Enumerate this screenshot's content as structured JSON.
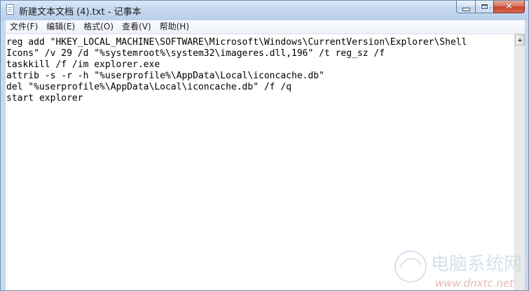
{
  "window": {
    "title": "新建文本文档 (4).txt - 记事本",
    "colors": {
      "frame": "#c7d9ed",
      "close_button": "#c7402b",
      "text": "#000000",
      "background": "#ffffff"
    }
  },
  "titlebar": {
    "app_icon": "notepad-icon",
    "buttons": {
      "minimize": "minimize-icon",
      "maximize": "maximize-icon",
      "close": "close-icon"
    }
  },
  "menubar": {
    "items": [
      {
        "label": "文件(F)"
      },
      {
        "label": "编辑(E)"
      },
      {
        "label": "格式(O)"
      },
      {
        "label": "查看(V)"
      },
      {
        "label": "帮助(H)"
      }
    ]
  },
  "editor": {
    "lines": [
      "reg add \"HKEY_LOCAL_MACHINE\\SOFTWARE\\Microsoft\\Windows\\CurrentVersion\\Explorer\\Shell",
      "Icons\" /v 29 /d \"%systemroot%\\system32\\imageres.dll,196\" /t reg_sz /f",
      "taskkill /f /im explorer.exe",
      "attrib -s -r -h \"%userprofile%\\AppData\\Local\\iconcache.db\"",
      "del \"%userprofile%\\AppData\\Local\\iconcache.db\" /f /q",
      "start explorer"
    ]
  },
  "watermark": {
    "text": "www.dnxtc.net"
  }
}
